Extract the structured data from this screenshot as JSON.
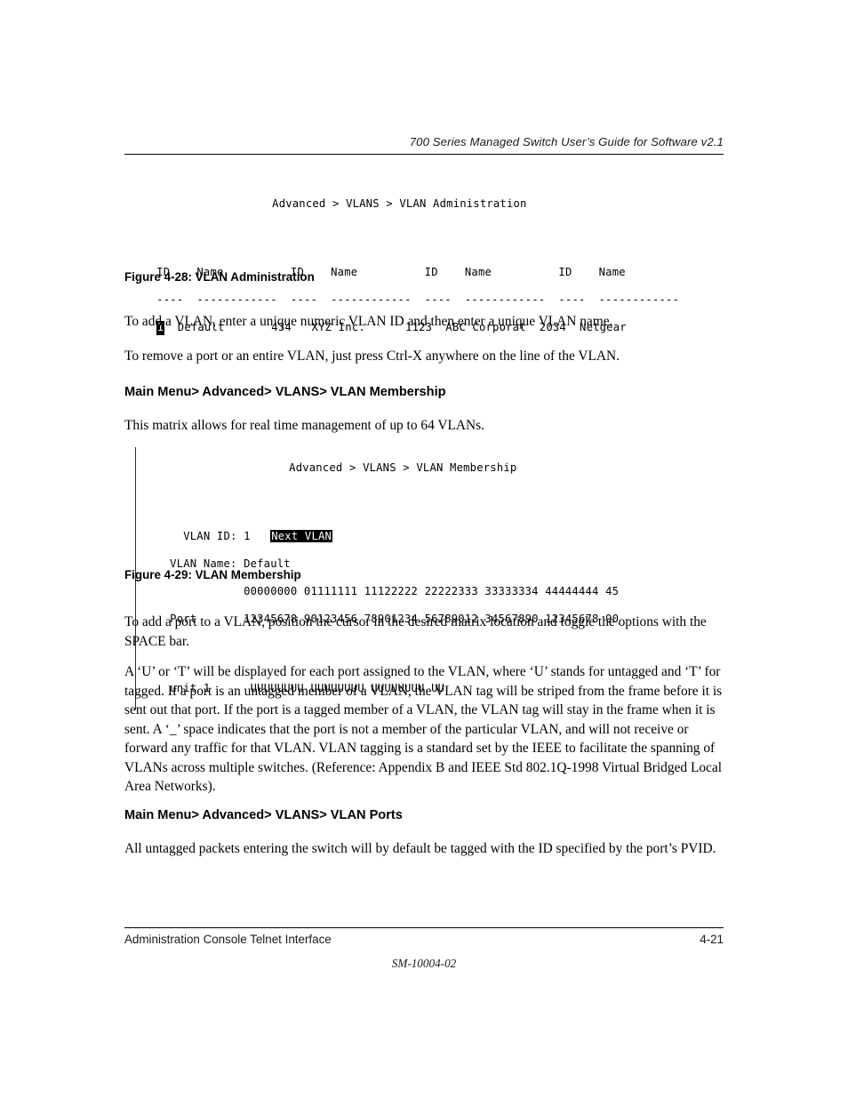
{
  "header": {
    "running_title": "700 Series Managed Switch User’s Guide for Software v2.1"
  },
  "figure_vlan_administration": {
    "breadcrumb": "Advanced > VLANS > VLAN Administration",
    "column_headers": "ID    Name          ID    Name          ID    Name          ID    Name",
    "separator_rule": "----  ------------  ----  ------------  ----  ------------  ----  ------------",
    "row_prefix": "1",
    "row_rest": "  Default       434   XYZ Inc.      1123  ABC Corporat  2034  Netgear",
    "entries": [
      {
        "id": "1",
        "name": "Default"
      },
      {
        "id": "434",
        "name": "XYZ Inc."
      },
      {
        "id": "1123",
        "name": "ABC Corporat"
      },
      {
        "id": "2034",
        "name": "Netgear"
      }
    ],
    "caption": "Figure 4-28:  VLAN Administration"
  },
  "figure_vlan_membership": {
    "breadcrumb": "Advanced > VLANS > VLAN Membership",
    "vlan_id_label": "  VLAN ID:",
    "vlan_id_value": " 1   ",
    "next_vlan_button": "Next VLAN",
    "vlan_name_label": "VLAN Name:",
    "vlan_name_value": " Default",
    "port_tens_row": "           00000000 01111111 11122222 22222333 33333334 44444444 45",
    "port_label": "Port",
    "port_ones_row": "       12345678 90123456 78901234 56789012 34567890 12345678 90",
    "unit_label": "unit 1",
    "unit_values": "      UUUUUUUU UUUUUUUU UUUUUUUU UU",
    "caption": "Figure 4-29:  VLAN Membership"
  },
  "body": {
    "p_add_vlan": "To add a VLAN, enter a unique numeric VLAN ID and then enter a unique VLAN name.",
    "p_remove_vlan": "To remove a port or an entire VLAN, just press Ctrl-X anywhere on the line of the VLAN.",
    "heading_membership": "Main Menu> Advanced> VLANS> VLAN Membership",
    "p_matrix": "This matrix allows for real time management of up to 64 VLANs.",
    "p_add_port": "To add a port to a VLAN, position the cursor in the desired matrix location and toggle the options with the SPACE bar.",
    "p_tagging": "A ‘U’ or ‘T’ will be displayed for each port assigned to the VLAN, where ‘U’ stands for untagged and ‘T’ for tagged. If a port is an untagged member of  a VLAN, the VLAN tag will be striped from the frame before it is sent out that port.  If the port is a tagged member of a VLAN, the VLAN tag will stay in the frame when it is sent.  A ‘_’ space indicates that the port is not a member of the particular VLAN, and will not receive or forward any traffic for that VLAN. VLAN tagging is a standard set by the IEEE to facilitate the spanning of VLANs across multiple switches. (Reference: Appendix B and IEEE Std 802.1Q-1998 Virtual Bridged Local Area Networks).",
    "heading_ports": "Main Menu> Advanced> VLANS> VLAN Ports",
    "p_pvid": "All untagged packets entering the switch will by default be tagged with the ID specified by the port’s PVID."
  },
  "footer": {
    "left": "Administration Console Telnet Interface",
    "right": "4-21",
    "doc_id": "SM-10004-02"
  }
}
